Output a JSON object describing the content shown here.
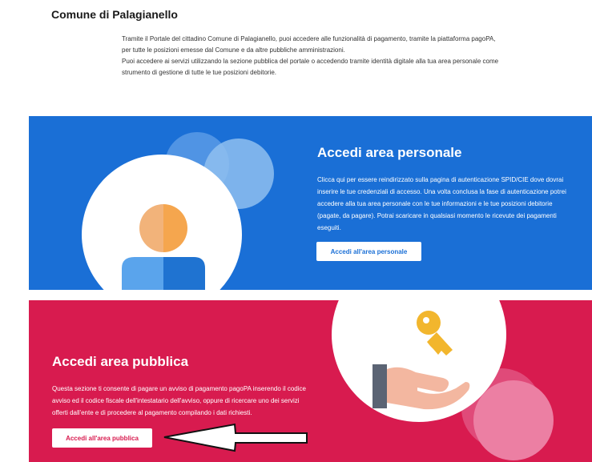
{
  "page": {
    "title": "Comune di Palagianello",
    "intro": [
      "Tramite il Portale del cittadino Comune di Palagianello, puoi accedere alle funzionalità di pagamento, tramite la piattaforma pagoPA, per tutte le posizioni emesse dal Comune e da altre pubbliche amministrazioni.",
      "Puoi accedere ai servizi utilizzando la sezione pubblica del portale o accedendo tramite identità digitale alla tua area personale come strumento di gestione di tutte le tue posizioni debitorie."
    ]
  },
  "personal_area": {
    "title": "Accedi area personale",
    "description": "Clicca qui per essere reindirizzato sulla pagina di autenticazione SPID/CIE dove dovrai inserire le tue credenziali di accesso. Una volta conclusa la fase di autenticazione potrei accedere alla tua area personale con le tue informazioni e le tue posizioni debitorie (pagate, da pagare). Potrai scaricare in qualsiasi momento le ricevute dei pagamenti eseguiti.",
    "button_label": "Accedi all'area personale",
    "icon": "user-avatar-icon",
    "bg_color": "#1a6fd6"
  },
  "public_area": {
    "title": "Accedi area pubblica",
    "description": "Questa sezione ti consente di pagare un avviso di pagamento pagoPA inserendo il codice avviso ed il codice fiscale dell'intestatario dell'avviso, oppure di ricercare uno dei servizi offerti dall'ente e di procedere al pagamento compilando i dati richiesti.",
    "button_label": "Accedi all'area pubblica",
    "icon": "hand-with-key-icon",
    "bg_color": "#d81b4f"
  },
  "annotation": {
    "icon": "arrow-left-icon"
  }
}
